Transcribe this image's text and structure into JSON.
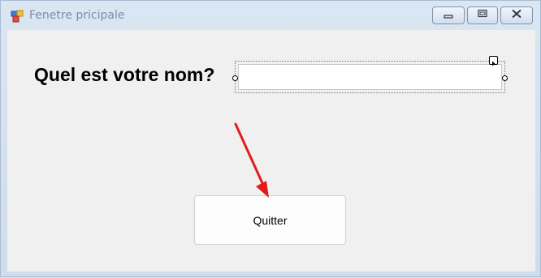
{
  "window": {
    "title": "Fenetre pricipale",
    "icon": "form-app-icon",
    "controls": [
      "minimize-icon",
      "maximize-icon",
      "close-icon"
    ]
  },
  "form": {
    "question_label": "Quel est votre nom?",
    "name_input": {
      "value": "",
      "placeholder": ""
    },
    "quit_button_label": "Quitter"
  },
  "annotation": {
    "arrow_icon": "red-arrow-icon",
    "color": "#e31b1b"
  },
  "colors": {
    "client_bg": "#f0f0f0",
    "title_text": "#7d8ea3"
  }
}
